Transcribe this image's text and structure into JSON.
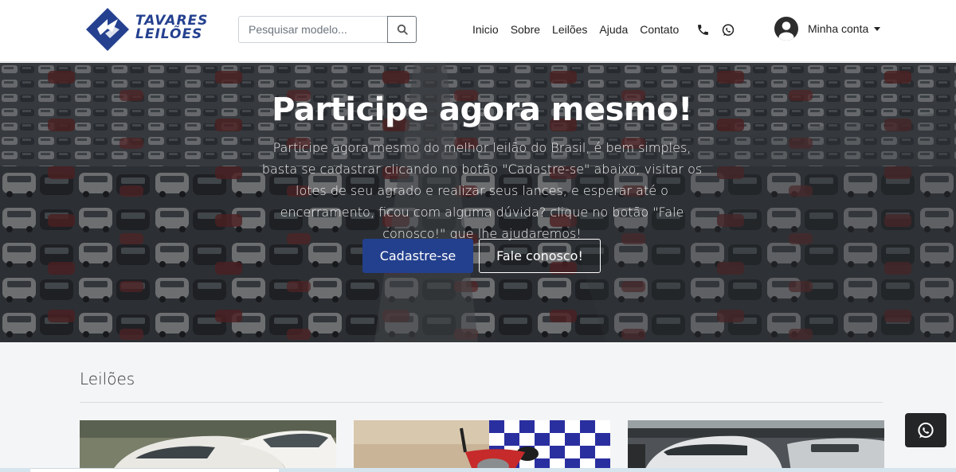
{
  "brand": {
    "line1": "TAVARES",
    "line2": "LEILÕES",
    "color": "#24408f"
  },
  "search": {
    "placeholder": "Pesquisar modelo...",
    "value": "",
    "button_icon": "search-icon"
  },
  "nav": {
    "links": [
      "Inicio",
      "Sobre",
      "Leilões",
      "Ajuda",
      "Contato"
    ],
    "phone_icon": "phone-icon",
    "whatsapp_icon": "whatsapp-icon"
  },
  "account": {
    "label": "Minha conta",
    "icon": "user-avatar-icon"
  },
  "hero": {
    "title": "Participe agora mesmo!",
    "text": "Participe agora mesmo do melhor leilão do Brasil, é bem simples, basta se cadastrar clicando no botão \"Cadastre-se\" abaixo, visitar os lotes de seu agrado e realizar seus lances, e esperar até o encerramento, ficou com alguma dúvida? clique no botão \"Fale conosco!\" que lhe ajudaremos!",
    "primary_button": "Cadastre-se",
    "secondary_button": "Fale conosco!",
    "primary_color": "#23408e"
  },
  "section": {
    "title": "Leilões",
    "cards": [
      {
        "image": "white-car-photo"
      },
      {
        "image": "motorcycle-checkered-flag-photo"
      },
      {
        "image": "damaged-cars-lot-photo"
      }
    ]
  },
  "floating": {
    "icon": "whatsapp-icon"
  }
}
